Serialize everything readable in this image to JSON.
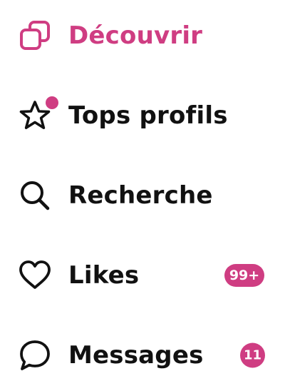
{
  "colors": {
    "accent": "#cf3d82",
    "text": "#111111",
    "background": "#ffffff"
  },
  "nav": {
    "items": [
      {
        "id": "discover",
        "label": "Découvrir",
        "icon": "discover-cards-icon",
        "active": true
      },
      {
        "id": "top-profiles",
        "label": "Tops profils",
        "icon": "star-icon",
        "has_notification_dot": true
      },
      {
        "id": "search",
        "label": "Recherche",
        "icon": "search-icon"
      },
      {
        "id": "likes",
        "label": "Likes",
        "icon": "heart-icon",
        "badge": "99+"
      },
      {
        "id": "messages",
        "label": "Messages",
        "icon": "chat-bubble-icon",
        "badge": "11"
      }
    ]
  }
}
